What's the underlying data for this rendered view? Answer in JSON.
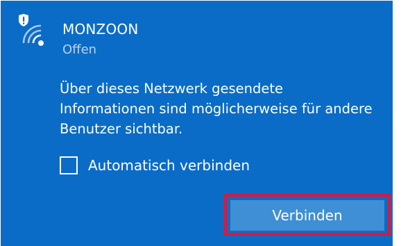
{
  "network": {
    "name": "MONZOON",
    "status": "Offen",
    "icon": "wifi-shield-icon"
  },
  "warning": {
    "text": "Über dieses Netzwerk gesendete\nInformationen sind möglicherweise für andere\nBenutzer sichtbar."
  },
  "auto_connect": {
    "label": "Automatisch verbinden",
    "checked": false
  },
  "connect_button": {
    "label": "Verbinden"
  },
  "colors": {
    "panel": "#0a6cc7",
    "button": "#3f8fd6",
    "highlight": "#d9183f",
    "secondary_text": "#b8d4ef"
  }
}
